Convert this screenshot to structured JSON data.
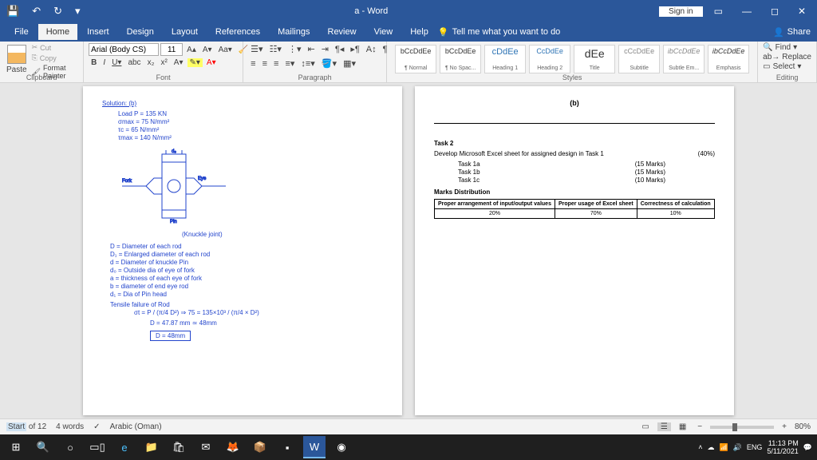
{
  "titleBar": {
    "docTitle": "a - Word",
    "signIn": "Sign in"
  },
  "tabs": [
    "File",
    "Home",
    "Insert",
    "Design",
    "Layout",
    "References",
    "Mailings",
    "Review",
    "View",
    "Help"
  ],
  "tellMe": "Tell me what you want to do",
  "share": "Share",
  "clipboard": {
    "paste": "Paste",
    "cut": "Cut",
    "copy": "Copy",
    "formatPainter": "Format Painter",
    "label": "Clipboard"
  },
  "font": {
    "name": "Arial (Body CS)",
    "size": "11",
    "label": "Font"
  },
  "paragraph": {
    "label": "Paragraph"
  },
  "styles": {
    "label": "Styles",
    "items": [
      {
        "preview": "bCcDdEe",
        "name": "¶ Normal"
      },
      {
        "preview": "bCcDdEe",
        "name": "¶ No Spac..."
      },
      {
        "preview": "cDdEe",
        "name": "Heading 1"
      },
      {
        "preview": "CcDdEe",
        "name": "Heading 2"
      },
      {
        "preview": "dEe",
        "name": "Title"
      },
      {
        "preview": "cCcDdEe",
        "name": "Subtitle"
      },
      {
        "preview": "ibCcDdEe",
        "name": "Subtle Em..."
      },
      {
        "preview": "ibCcDdEe",
        "name": "Emphasis"
      }
    ]
  },
  "editing": {
    "find": "Find",
    "replace": "Replace",
    "select": "Select",
    "label": "Editing"
  },
  "pageA": {
    "title": "Solution: (b)",
    "lines": [
      "Load P = 135 KN",
      "σmax = 75 N/mm²",
      "τc = 65 N/mm²",
      "τmax = 140 N/mm²"
    ],
    "drawingLabel": "(Knuckle joint)",
    "defs": [
      "D = Diameter of each rod",
      "D₁ = Enlarged diameter of each rod",
      "d = Diameter of knuckle Pin",
      "d₀ = Outside dia of eye of fork",
      "a = thickness of each eye of fork",
      "b = diameter of end eye rod",
      "d₁ = Dia of Pin head"
    ],
    "calc1": "Tensile failure of Rod",
    "calc2": "σt = P / (π/4 D²)   ⇒   75 = 135×10³ / (π/4 × D²)",
    "calc3": "D = 47.87 mm ≃ 48mm",
    "result": "D = 48mm"
  },
  "pageB": {
    "header": "(b)",
    "task": "Task 2",
    "desc": "Develop Microsoft Excel sheet for assigned design in Task 1",
    "descPct": "(40%)",
    "rows": [
      {
        "label": "Task 1a",
        "marks": "(15 Marks)"
      },
      {
        "label": "Task 1b",
        "marks": "(15 Marks)"
      },
      {
        "label": "Task 1c",
        "marks": "(10 Marks)"
      }
    ],
    "tableTitle": "Marks Distribution",
    "tableHeaders": [
      "Proper arrangement of input/output values",
      "Proper usage of Excel sheet",
      "Correctness of calculation"
    ],
    "tableValues": [
      "20%",
      "70%",
      "10%"
    ]
  },
  "statusBar": {
    "page": "of 12",
    "pageStart": "Start",
    "words": "4 words",
    "lang": "Arabic (Oman)",
    "zoom": "80%"
  },
  "taskbar": {
    "lang": "ENG",
    "time": "11:13 PM",
    "date": "5/11/2021"
  }
}
